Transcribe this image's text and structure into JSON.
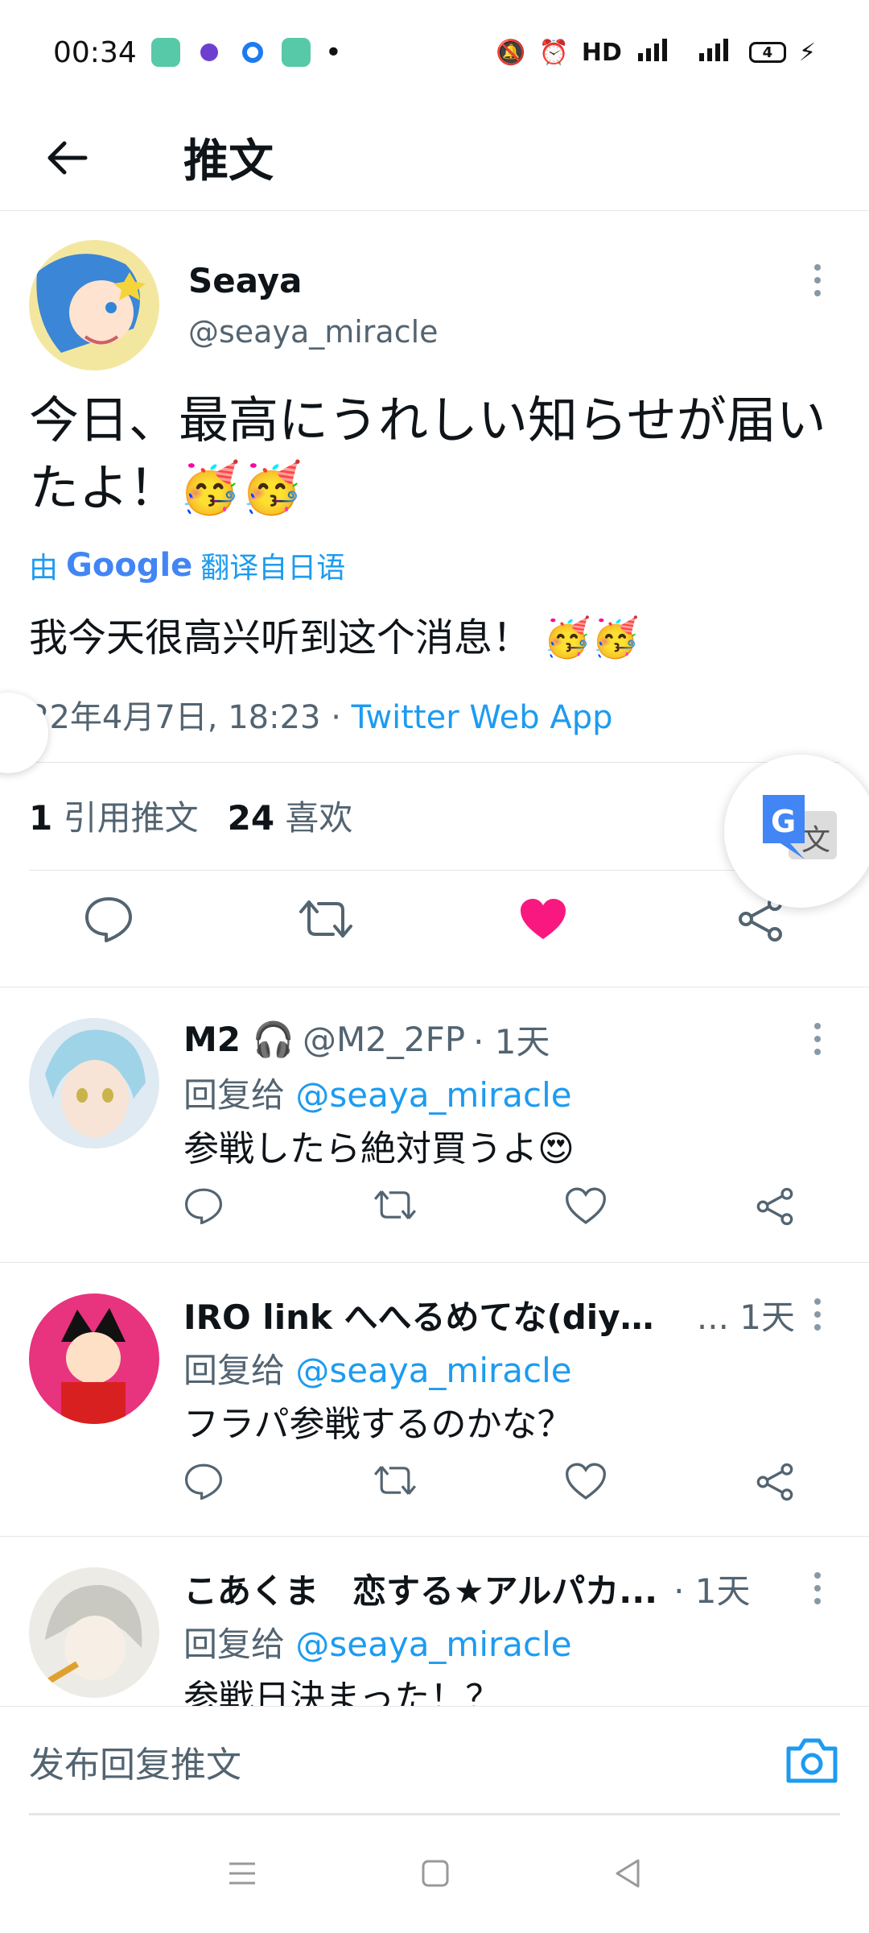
{
  "status_bar": {
    "time": "00:34",
    "network": "HD",
    "battery": "4"
  },
  "header": {
    "title": "推文"
  },
  "tweet": {
    "author_name": "Seaya",
    "author_handle": "@seaya_miracle",
    "text": "今日、最高にうれしい知らせが届いたよ！🥳🥳",
    "translate_prefix": "由",
    "translate_brand": "Google",
    "translate_suffix": "翻译自日语",
    "translated_text": "我今天很高兴听到这个消息！ 🥳🥳",
    "timestamp": "22年4月7日, 18:23",
    "separator": " · ",
    "client": "Twitter Web App",
    "quote_count": "1",
    "quote_label": "引用推文",
    "like_count": "24",
    "like_label": "喜欢",
    "liked": true
  },
  "replies": [
    {
      "name": "M2 🎧",
      "handle": "@M2_2FP",
      "time": "· 1天",
      "reply_prefix": "回复给",
      "reply_to": "@seaya_miracle",
      "text": "参戦したら絶対買うよ😍"
    },
    {
      "name": "IRO link へへるめてな(diyの夫)",
      "handle": "",
      "time": "... 1天",
      "reply_prefix": "回复给",
      "reply_to": "@seaya_miracle",
      "text": "フラパ参戦するのかな？"
    },
    {
      "name": "こあくま　恋する★アルパカ...",
      "handle": "",
      "time": "· 1天",
      "reply_prefix": "回复给",
      "reply_to": "@seaya_miracle",
      "text": "参戦日決まった！？"
    }
  ],
  "compose": {
    "placeholder": "发布回复推文"
  },
  "colors": {
    "accent": "#1d9bf0",
    "like": "#f91880",
    "muted": "#536471"
  },
  "icons": [
    "back-arrow-icon",
    "reply-icon",
    "retweet-icon",
    "heart-icon",
    "share-icon",
    "camera-icon",
    "more-icon",
    "google-translate-icon"
  ]
}
